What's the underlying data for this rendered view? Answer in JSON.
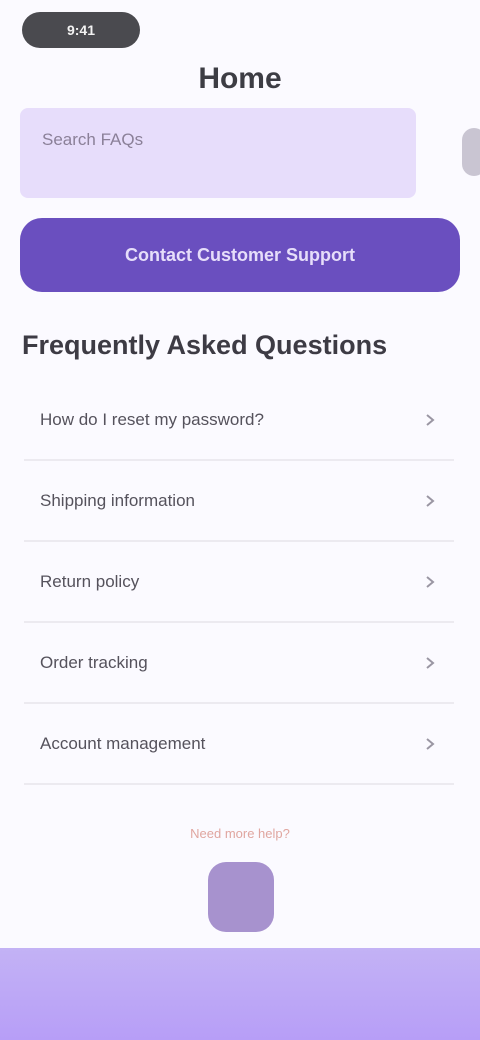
{
  "status": {
    "time": "9:41"
  },
  "header": {
    "title": "Home"
  },
  "search": {
    "placeholder": "Search FAQs"
  },
  "cta": {
    "label": "Contact Customer Support"
  },
  "faq": {
    "heading": "Frequently Asked Questions",
    "items": [
      {
        "question": "How do I reset my password?"
      },
      {
        "question": "Shipping information"
      },
      {
        "question": "Return policy"
      },
      {
        "question": "Order tracking"
      },
      {
        "question": "Account management"
      }
    ]
  },
  "footer": {
    "text": "Need more help?"
  },
  "colors": {
    "accent": "#6a4fbf",
    "search_bg": "#e7ddfb",
    "bottom_bar": "#b79ef7",
    "fab": "#a792ce"
  },
  "icons": {
    "faq_chevron": "chevron-right-icon"
  }
}
